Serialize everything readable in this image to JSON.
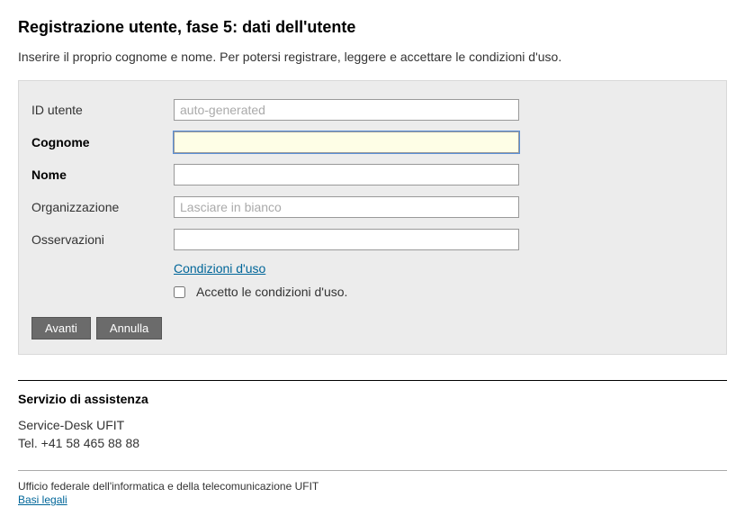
{
  "header": {
    "title": "Registrazione utente, fase 5: dati dell'utente",
    "intro": "Inserire il proprio cognome e nome. Per potersi registrare, leggere e accettare le condizioni d'uso."
  },
  "form": {
    "fields": {
      "id_utente": {
        "label": "ID utente",
        "placeholder": "auto-generated",
        "value": ""
      },
      "cognome": {
        "label": "Cognome",
        "value": ""
      },
      "nome": {
        "label": "Nome",
        "value": ""
      },
      "organizzazione": {
        "label": "Organizzazione",
        "placeholder": "Lasciare in bianco",
        "value": ""
      },
      "osservazioni": {
        "label": "Osservazioni",
        "value": ""
      }
    },
    "terms_link": "Condizioni d'uso",
    "accept_label": "Accetto le condizioni d'uso.",
    "buttons": {
      "next": "Avanti",
      "cancel": "Annulla"
    }
  },
  "assistance": {
    "title": "Servizio di assistenza",
    "line1": "Service-Desk UFIT",
    "line2": "Tel. +41 58 465 88 88"
  },
  "footer": {
    "org": "Ufficio federale dell'informatica e della telecomunicazione UFIT",
    "legal_link": "Basi legali"
  }
}
